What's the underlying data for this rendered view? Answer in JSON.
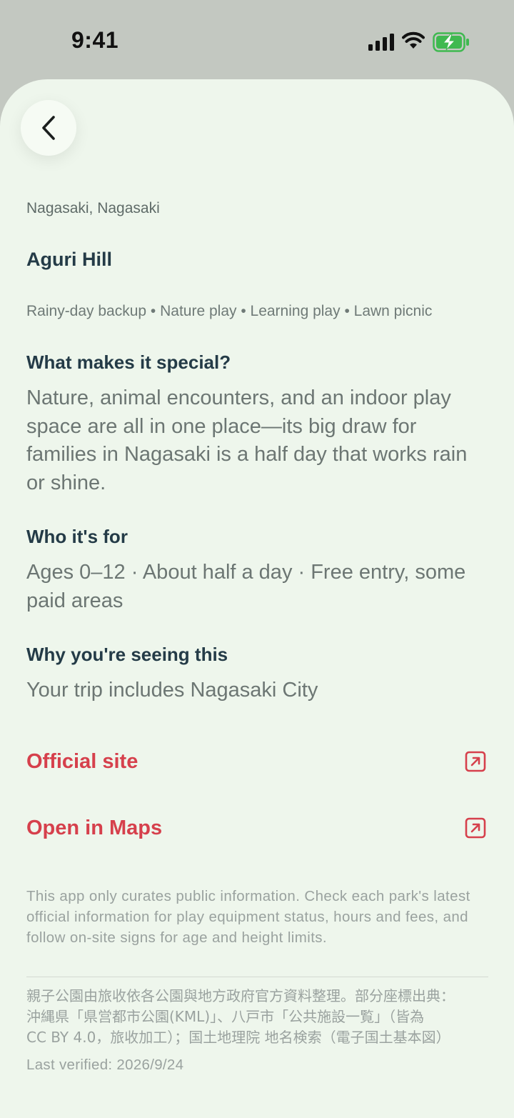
{
  "status_bar": {
    "time": "9:41",
    "icons": [
      "signal-icon",
      "wifi-icon",
      "battery-charging-icon"
    ],
    "battery_color": "#3fb950"
  },
  "header": {
    "back_icon": "chevron-left-icon"
  },
  "place": {
    "location": "Nagasaki, Nagasaki",
    "name": "Aguri Hill",
    "tags": "Rainy-day backup • Nature play • Learning play • Lawn picnic"
  },
  "sections": {
    "special": {
      "heading": "What makes it special?",
      "body": "Nature, animal encounters, and an indoor play space are all in one place—its big draw for families in Nagasaki is a half day that works rain or shine."
    },
    "who": {
      "heading": "Who it's for",
      "body": "Ages 0–12 · About half a day · Free entry, some paid areas"
    },
    "why": {
      "heading": "Why you're seeing this",
      "body": "Your trip includes Nagasaki City"
    }
  },
  "links": {
    "official": {
      "label": "Official site",
      "icon": "external-link-icon"
    },
    "maps": {
      "label": "Open in Maps",
      "icon": "external-link-icon"
    },
    "accent_color": "#d6404c"
  },
  "footer": {
    "disclaimer": "This app only curates public information. Check each park's latest official information for play equipment status, hours and fees, and follow on-site signs for age and height limits.",
    "attribution": "親子公園由旅收依各公園與地方政府官方資料整理。部分座標出典：\n沖縄県「県営都市公園(KML)」、八戸市「公共施設一覧」（皆為\nCC BY 4.0，旅收加工）；国土地理院 地名検索（電子国土基本図）",
    "last_verified": "Last verified: 2026/9/24"
  }
}
